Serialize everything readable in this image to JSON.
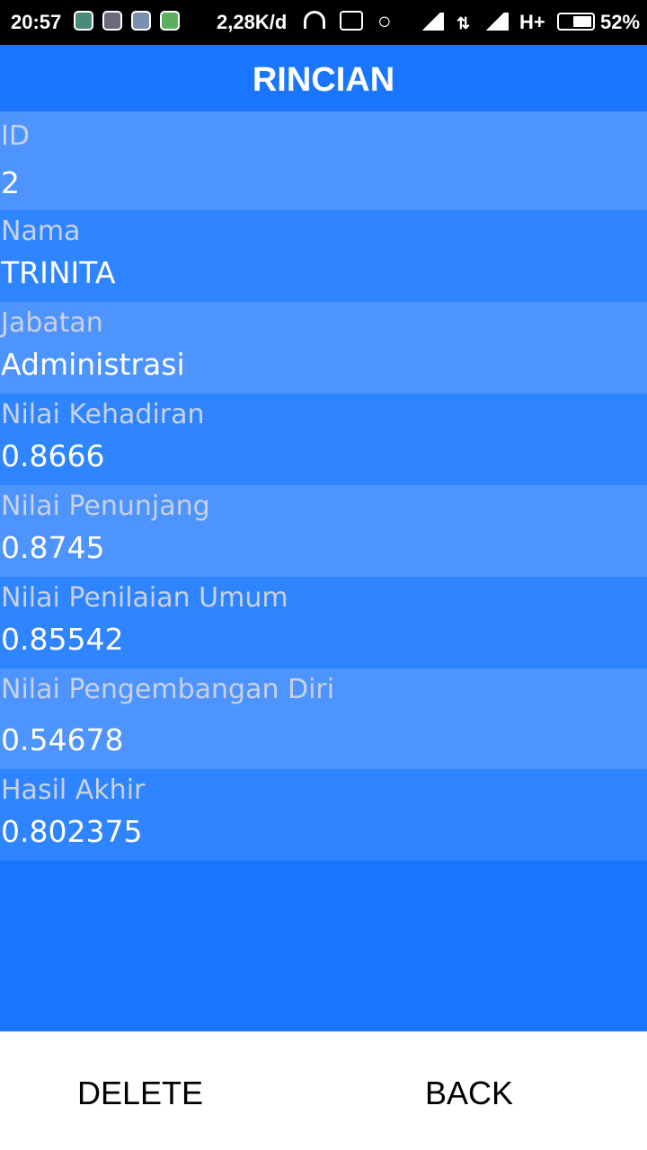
{
  "status_bar": {
    "time": "20:57",
    "speed": "2,28K/d",
    "network": "H+",
    "battery": "52%",
    "battery_level": 0.52,
    "icons": [
      "shield-notification-icon",
      "app-notification-icon",
      "browser-notification-icon",
      "android-notification-icon",
      "headset-icon",
      "vibrate-off-icon",
      "wifi-icon",
      "signal-icon",
      "data-transfer-icon",
      "signal-icon",
      "battery-icon"
    ]
  },
  "header": {
    "title": "RINCIAN"
  },
  "fields": [
    {
      "label": "ID",
      "value": "2"
    },
    {
      "label": "Nama",
      "value": "TRINITA"
    },
    {
      "label": "Jabatan",
      "value": "Administrasi"
    },
    {
      "label": "Nilai Kehadiran",
      "value": "0.8666"
    },
    {
      "label": "Nilai Penunjang",
      "value": "0.8745"
    },
    {
      "label": "Nilai Penilaian Umum",
      "value": "0.85542"
    },
    {
      "label": "Nilai Pengembangan Diri",
      "value": "0.54678"
    },
    {
      "label": "Hasil Akhir",
      "value": "0.802375"
    }
  ],
  "actions": {
    "delete_label": "DELETE",
    "back_label": "BACK"
  },
  "colors": {
    "primary": "#1a75ff",
    "row_light": "#4d94ff",
    "row_mid": "#2f84ff",
    "label_text": "#c8d1e0",
    "value_text": "#ffffff"
  }
}
